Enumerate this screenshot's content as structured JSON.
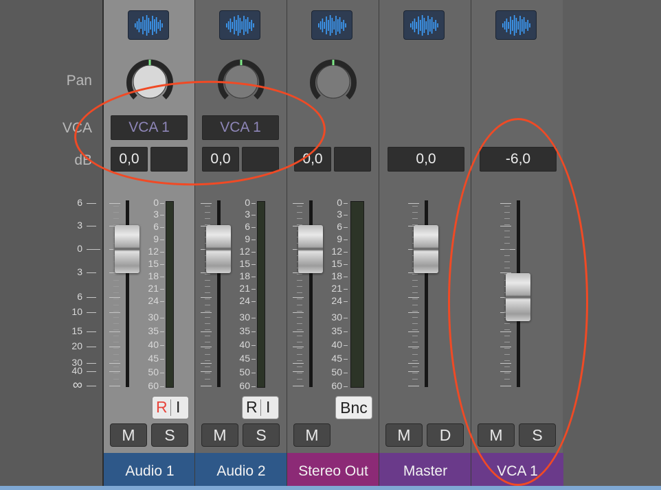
{
  "row_labels": {
    "pan": "Pan",
    "vca": "VCA",
    "db": "dB"
  },
  "left_scale": [
    "6",
    "3",
    "0",
    "3",
    "6",
    "10",
    "15",
    "20",
    "30",
    "40",
    "∞"
  ],
  "meter_scale": [
    "0",
    "3",
    "6",
    "9",
    "12",
    "15",
    "18",
    "21",
    "24",
    "30",
    "35",
    "40",
    "45",
    "50",
    "60"
  ],
  "strips": [
    {
      "name": "Audio 1",
      "color": "#2e5889",
      "vca": "VCA 1",
      "db": "0,0",
      "has_peak": true,
      "fader_db": 0,
      "record": "R",
      "input": "I",
      "mute": "M",
      "solo": "S",
      "selected": true
    },
    {
      "name": "Audio 2",
      "color": "#2e5889",
      "vca": "VCA 1",
      "db": "0,0",
      "has_peak": true,
      "fader_db": 0,
      "record": "R",
      "input": "I",
      "mute": "M",
      "solo": "S"
    },
    {
      "name": "Stereo Out",
      "color": "#8c2a76",
      "db": "0,0",
      "has_peak": true,
      "fader_db": 0,
      "bounce": "Bnc",
      "mute": "M"
    },
    {
      "name": "Master",
      "color": "#6a3a8a",
      "db": "0,0",
      "fader_db": 0,
      "mute": "M",
      "dim": "D"
    },
    {
      "name": "VCA 1",
      "color": "#6a3a8a",
      "db": "-6,0",
      "fader_db": -6,
      "mute": "M",
      "solo": "S"
    }
  ],
  "colors": {
    "record_active": "#e8453c",
    "annotation": "#f04a25",
    "accent_knob": "#7ee787"
  }
}
